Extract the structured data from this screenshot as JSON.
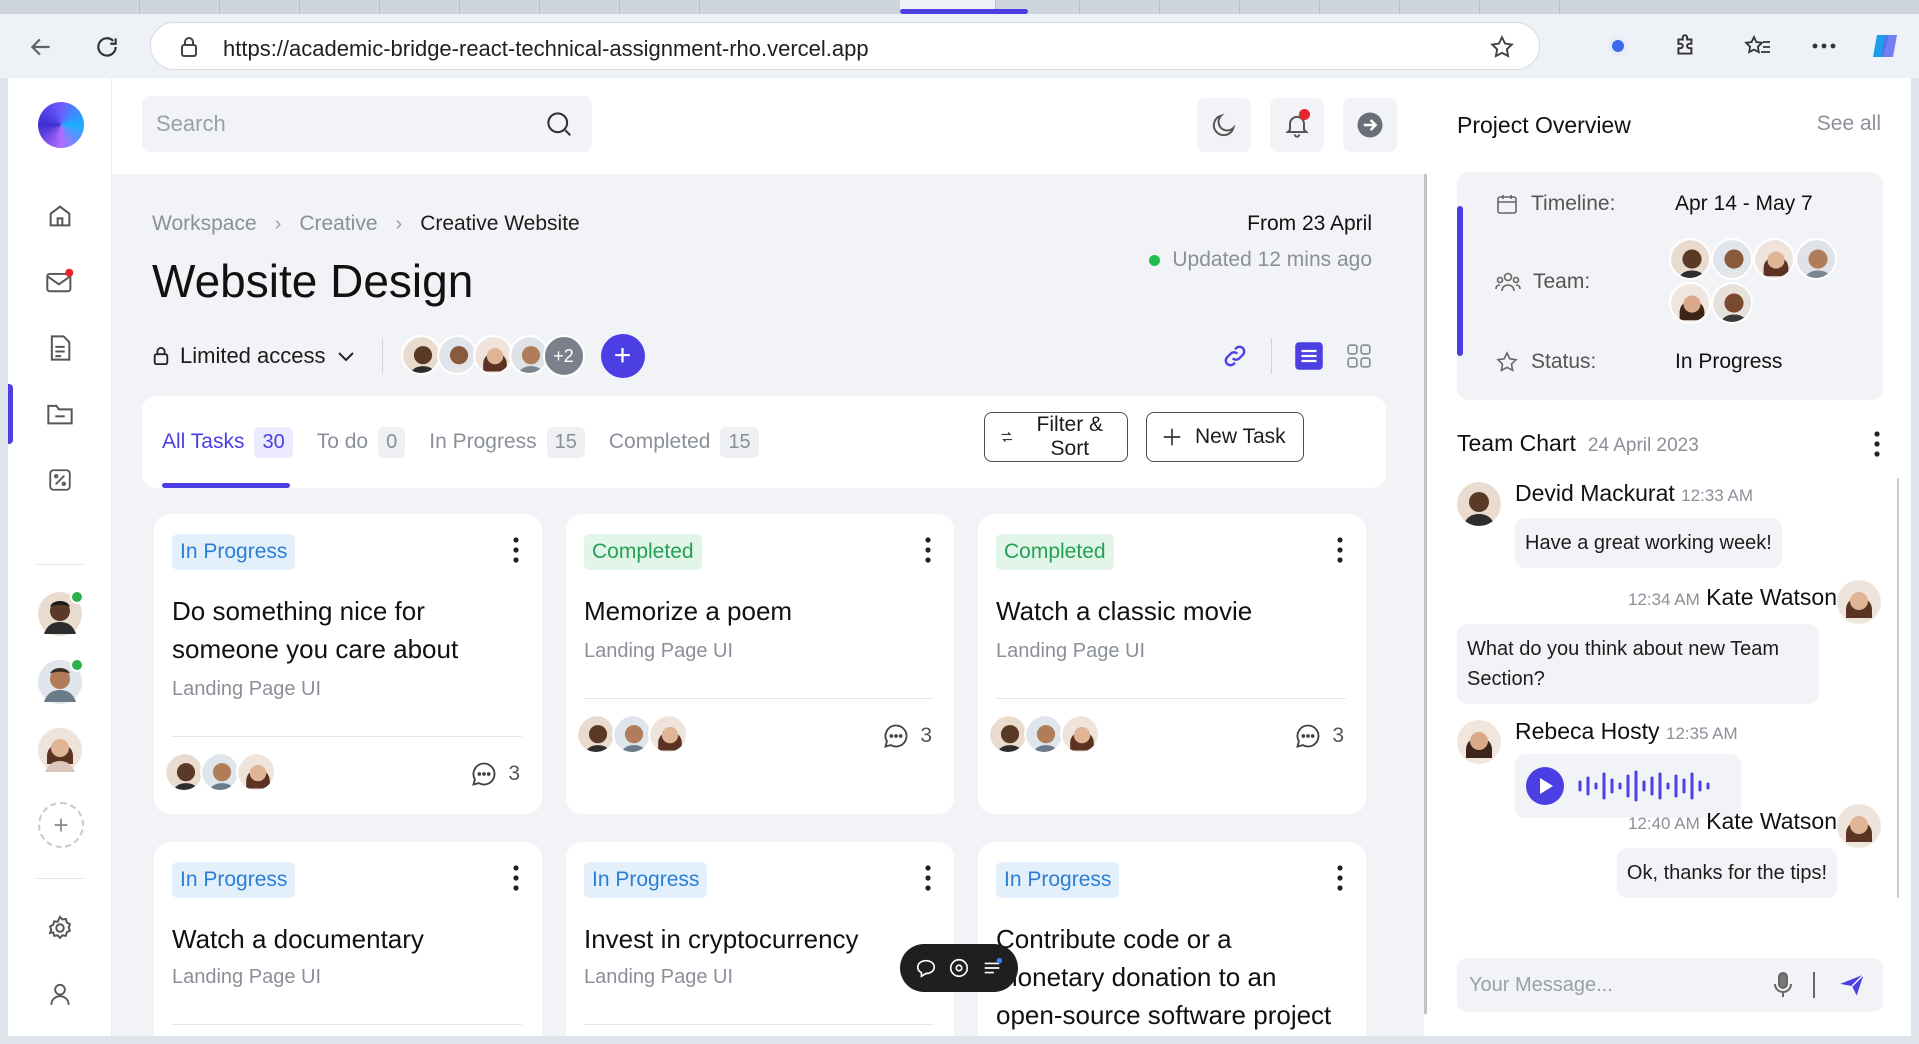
{
  "browser": {
    "url": "https://academic-bridge-react-technical-assignment-rho.vercel.app"
  },
  "topbar": {
    "search_placeholder": "Search"
  },
  "breadcrumb": [
    "Workspace",
    "Creative",
    "Creative Website"
  ],
  "page": {
    "title": "Website Design",
    "from_date": "From 23 April",
    "updated": "Updated 12 mins ago",
    "access": "Limited access",
    "members_more": "+2"
  },
  "tabs": [
    {
      "label": "All Tasks",
      "count": "30"
    },
    {
      "label": "To do",
      "count": "0"
    },
    {
      "label": "In Progress",
      "count": "15"
    },
    {
      "label": "Completed",
      "count": "15"
    }
  ],
  "actions": {
    "filter": "Filter & Sort",
    "new_task": "New Task"
  },
  "cards": [
    {
      "status": "In Progress",
      "title": "Do something nice for someone you care about",
      "subtitle": "Landing Page UI",
      "comments": "3"
    },
    {
      "status": "Completed",
      "title": "Memorize a poem",
      "subtitle": "Landing Page UI",
      "comments": "3"
    },
    {
      "status": "Completed",
      "title": "Watch a classic movie",
      "subtitle": "Landing Page UI",
      "comments": "3"
    },
    {
      "status": "In Progress",
      "title": "Watch a documentary",
      "subtitle": "Landing Page UI"
    },
    {
      "status": "In Progress",
      "title": "Invest in cryptocurrency",
      "subtitle": "Landing Page UI"
    },
    {
      "status": "In Progress",
      "title": "Contribute code or a monetary donation to an open-source software project"
    }
  ],
  "overview": {
    "title": "Project Overview",
    "see_all": "See all",
    "timeline_label": "Timeline:",
    "timeline_value": "Apr 14 - May 7",
    "team_label": "Team:",
    "status_label": "Status:",
    "status_value": "In Progress"
  },
  "chat": {
    "title": "Team Chart",
    "date": "24 April 2023",
    "messages": [
      {
        "name": "Devid Mackurat",
        "time": "12:33 AM",
        "text": "Have a great working week!"
      },
      {
        "name": "Kate Watson",
        "time": "12:34 AM",
        "text": "What do you think about new Team Section?"
      },
      {
        "name": "Rebeca Hosty",
        "time": "12:35 AM"
      },
      {
        "name": "Kate Watson",
        "time": "12:40 AM",
        "text": "Ok, thanks for the tips!"
      }
    ],
    "input_placeholder": "Your Message..."
  },
  "colors": {
    "accent": "#4b3fe4",
    "progress_badge": "#2a7fd4",
    "completed_badge": "#23a156",
    "online": "#2bb24c",
    "notification": "#e5252a"
  },
  "icons": [
    "back-icon",
    "reload-icon",
    "lock-icon",
    "star-icon",
    "extensions-icon",
    "favorites-icon",
    "more-icon",
    "copilot-icon",
    "home-icon",
    "mail-icon",
    "document-icon",
    "folder-icon",
    "percent-icon",
    "settings-icon",
    "user-icon",
    "search-icon",
    "moon-icon",
    "bell-icon",
    "logout-arrow-icon",
    "link-icon",
    "list-view-icon",
    "grid-view-icon",
    "filter-icon",
    "plus-icon",
    "kebab-icon",
    "comment-icon",
    "calendar-icon",
    "team-icon",
    "status-star-icon",
    "play-icon",
    "mic-icon",
    "send-icon"
  ]
}
